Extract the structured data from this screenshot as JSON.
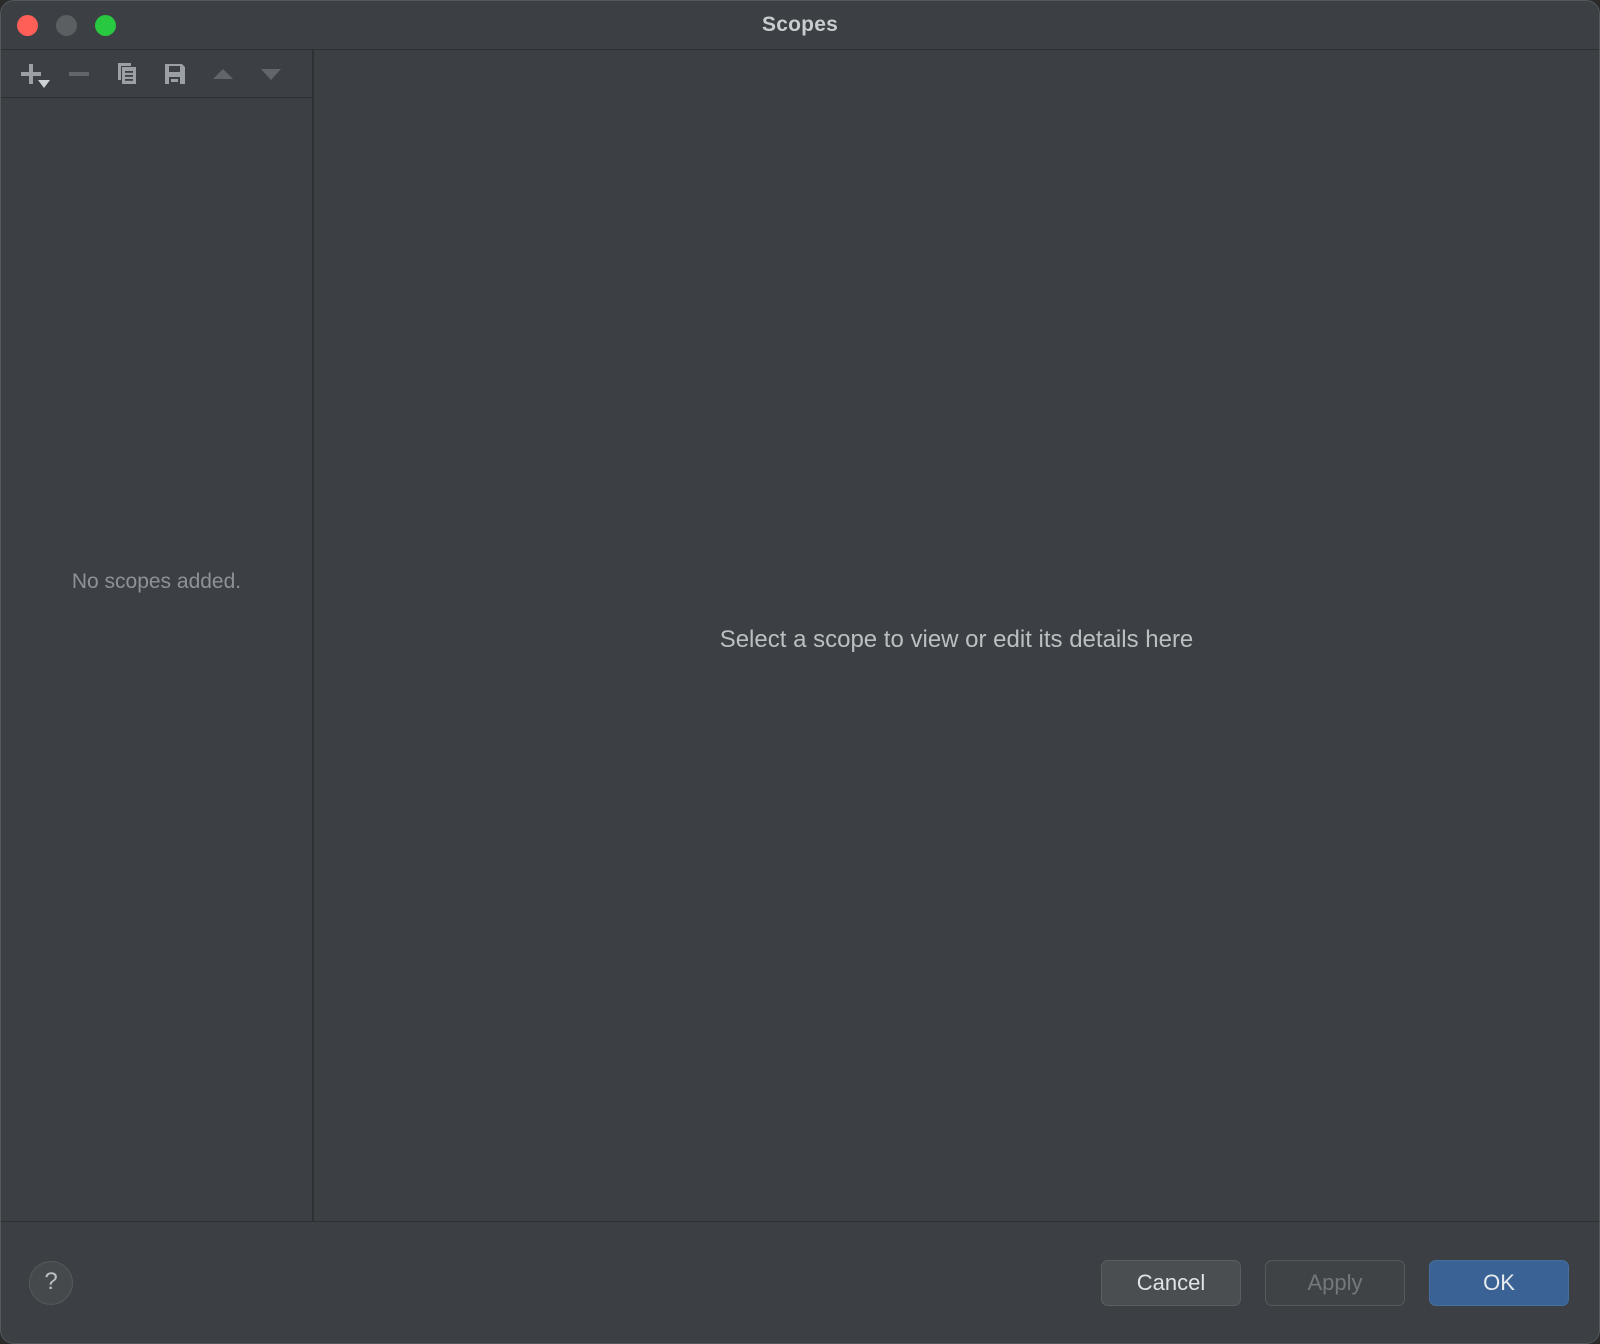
{
  "window": {
    "title": "Scopes",
    "traffic_lights": [
      {
        "name": "close",
        "color": "#ff5f57"
      },
      {
        "name": "minimize",
        "color": "#5b5f62"
      },
      {
        "name": "zoom",
        "color": "#28c840"
      }
    ]
  },
  "toolbar": {
    "buttons": [
      {
        "icon": "add-icon",
        "label": "Add",
        "enabled": true,
        "has_dropdown": true
      },
      {
        "icon": "remove-icon",
        "label": "Remove",
        "enabled": false,
        "has_dropdown": false
      },
      {
        "icon": "copy-icon",
        "label": "Copy",
        "enabled": true,
        "has_dropdown": false
      },
      {
        "icon": "save-icon",
        "label": "Save",
        "enabled": true,
        "has_dropdown": false
      },
      {
        "icon": "move-up-icon",
        "label": "Move Up",
        "enabled": false,
        "has_dropdown": false
      },
      {
        "icon": "move-down-icon",
        "label": "Move Down",
        "enabled": false,
        "has_dropdown": false
      }
    ]
  },
  "left_panel": {
    "empty_message": "No scopes added."
  },
  "right_panel": {
    "placeholder_message": "Select a scope to view or edit its details here"
  },
  "bottom_bar": {
    "help_label": "?",
    "cancel_label": "Cancel",
    "apply_label": "Apply",
    "ok_label": "OK"
  },
  "colors": {
    "background": "#3c4044",
    "divider": "#2e3134",
    "accent": "#3b6294",
    "text_primary": "#c8ccce",
    "text_muted": "#8d9296"
  }
}
